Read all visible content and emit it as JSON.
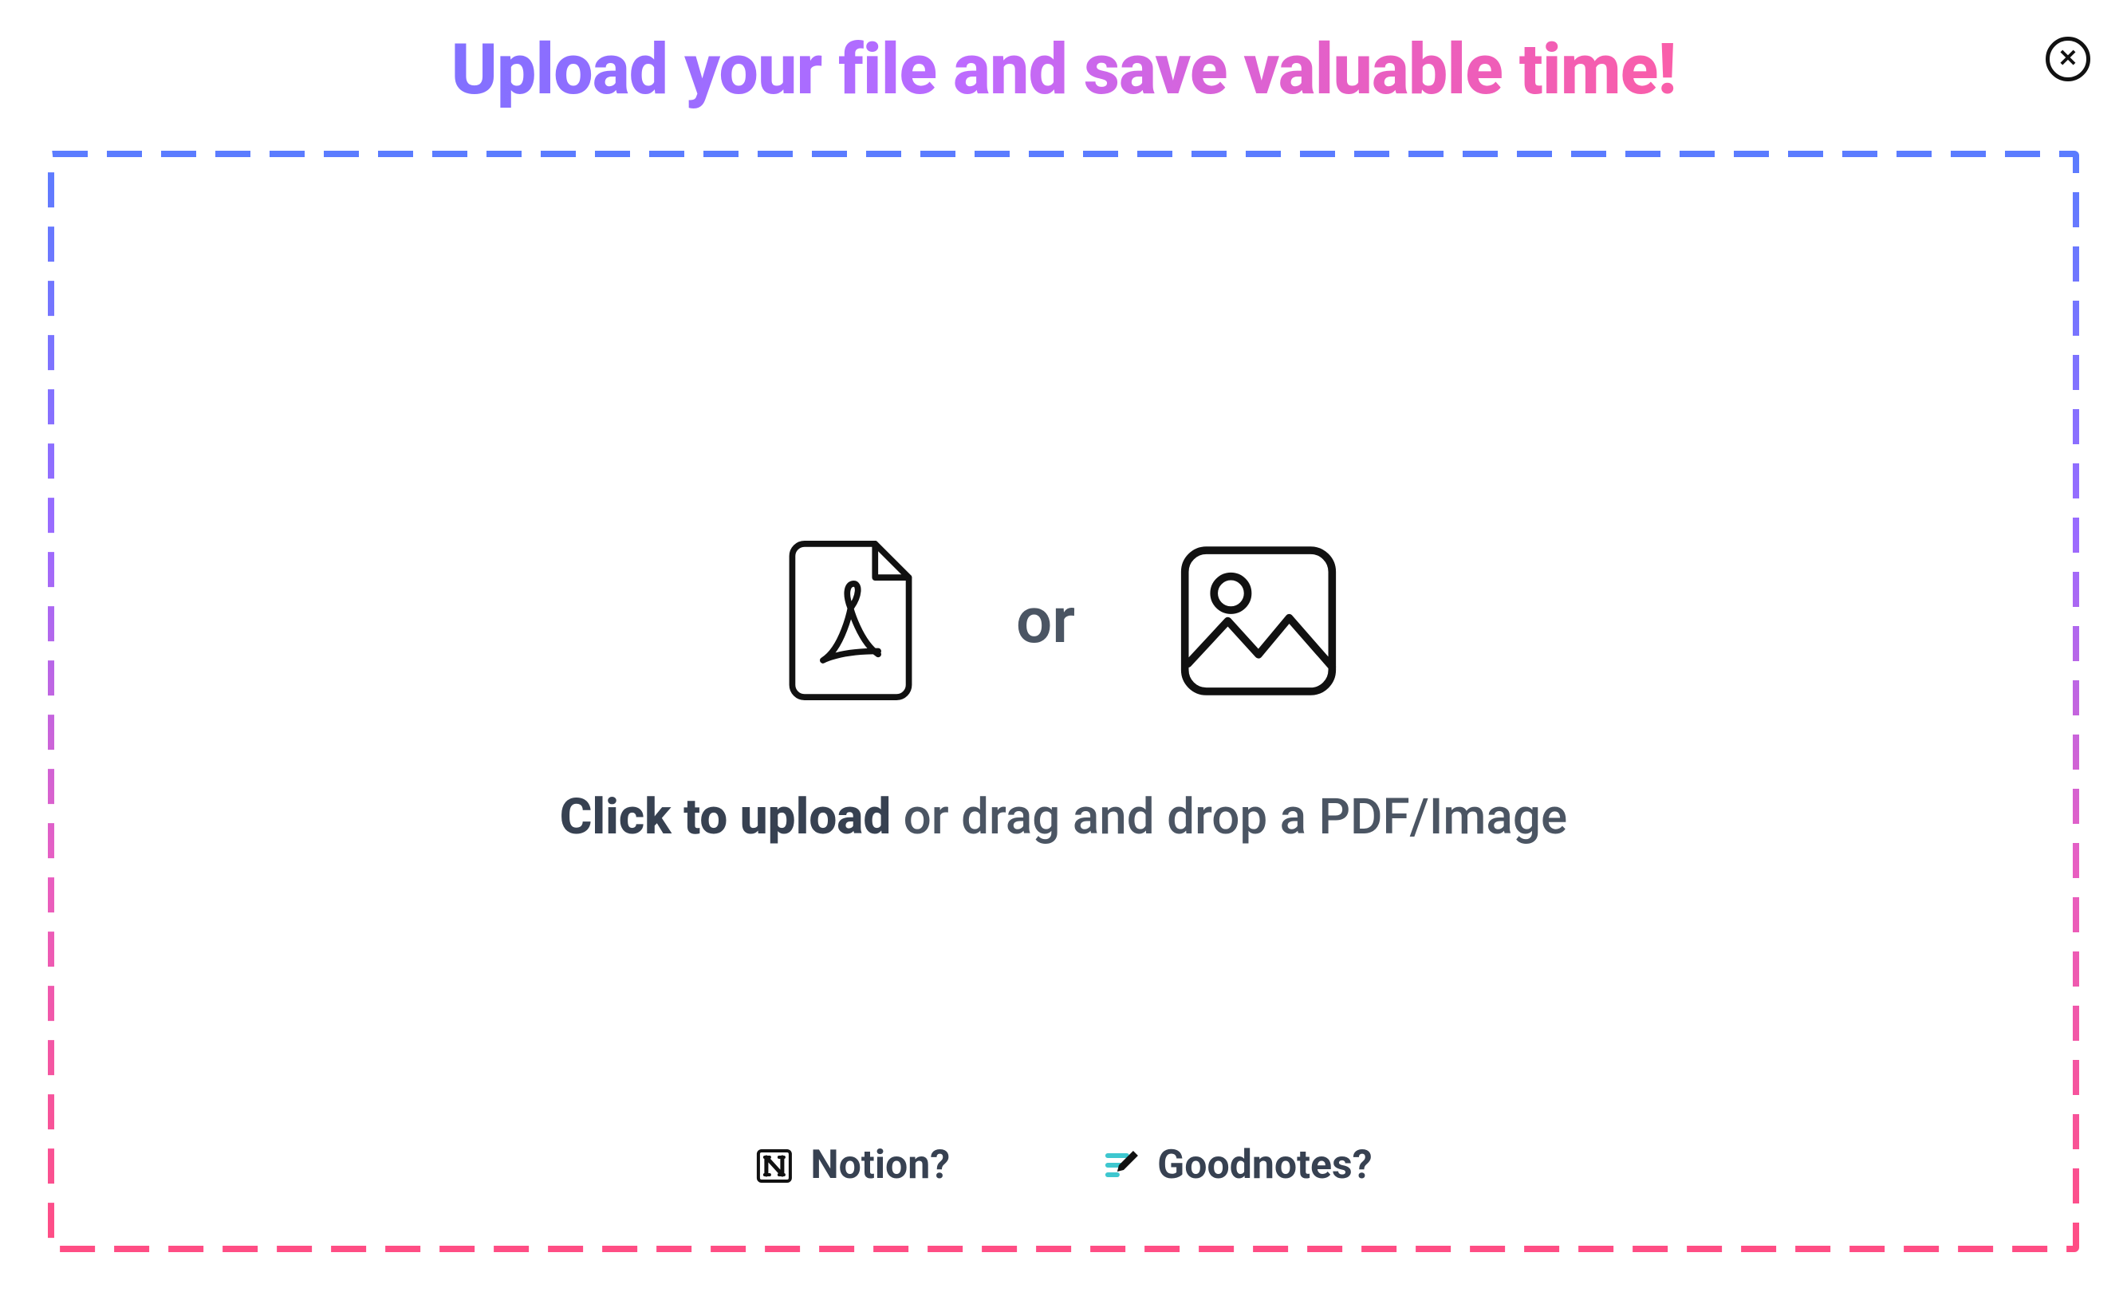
{
  "title": "Upload your file and save valuable time!",
  "upload": {
    "or": "or",
    "bold": "Click to upload",
    "rest": " or drag and drop a PDF/Image"
  },
  "footer": {
    "notion": "Notion?",
    "goodnotes": "Goodnotes?"
  }
}
